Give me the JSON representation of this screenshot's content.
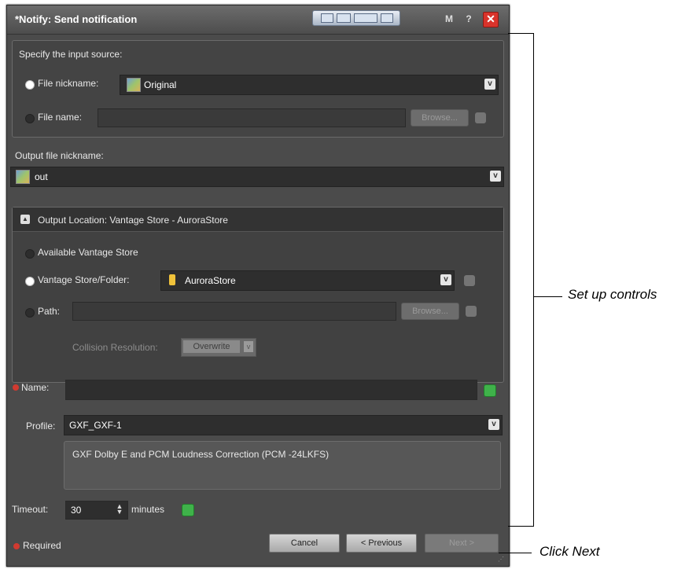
{
  "dialog": {
    "title": "*Notify: Send notification",
    "title_buttons": [
      "M",
      "?"
    ],
    "close_label": "✕"
  },
  "input_source": {
    "heading": "Specify the input source:",
    "nickname_label": "File nickname:",
    "nickname_value": "Original",
    "filename_label": "File name:",
    "browse_label": "Browse..."
  },
  "output_nickname": {
    "label": "Output file nickname:",
    "value": "out"
  },
  "output_location": {
    "header": "Output Location: Vantage Store - AuroraStore",
    "available_label": "Available Vantage Store",
    "store_label": "Vantage Store/Folder:",
    "store_value": "AuroraStore",
    "path_label": "Path:",
    "browse_label": "Browse...",
    "collision_label": "Collision Resolution:",
    "collision_value": "Overwrite"
  },
  "name": {
    "label": "Name:",
    "value": ""
  },
  "profile": {
    "label": "Profile:",
    "value": "GXF_GXF-1",
    "description": "GXF Dolby E and PCM Loudness Correction (PCM -24LKFS)"
  },
  "timeout": {
    "label": "Timeout:",
    "value": "30",
    "unit": "minutes"
  },
  "footer": {
    "required_label": "Required",
    "cancel_label": "Cancel",
    "previous_label": "< Previous",
    "next_label": "Next >"
  },
  "annotations": {
    "setup": "Set up controls",
    "next": "Click Next"
  }
}
